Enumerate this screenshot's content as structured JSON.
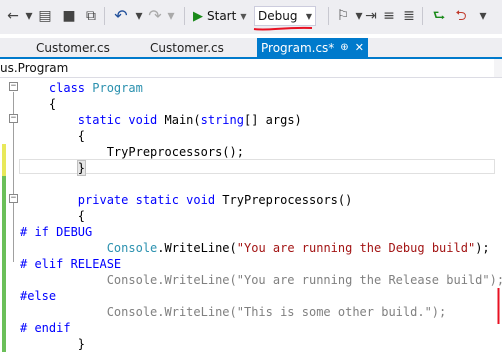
{
  "toolbar": {
    "start_label": "Start",
    "config_value": "Debug",
    "icons": [
      "navigate-back-icon",
      "dropdown-icon",
      "new-project-icon",
      "save-icon",
      "save-all-icon",
      "undo-icon",
      "redo-icon",
      "start-play-icon",
      "bookmark-icon",
      "step-icon",
      "format-icon",
      "comment-icon",
      "uncomment-icon"
    ]
  },
  "tabs": [
    {
      "label": "Customer.cs"
    },
    {
      "label": "Customer.cs"
    },
    {
      "label": "Program.cs*",
      "pin": "⊕",
      "close": "✕"
    }
  ],
  "navbar": {
    "scope": "us.Program"
  },
  "code_lines": [
    {
      "indent": 0,
      "parts": []
    },
    {
      "indent": 0,
      "parts": [
        {
          "t": "    class ",
          "c": "kw"
        },
        {
          "t": "Program",
          "c": "cls"
        }
      ]
    },
    {
      "indent": 0,
      "parts": [
        {
          "t": "    {",
          "c": ""
        }
      ]
    },
    {
      "indent": 0,
      "parts": [
        {
          "t": "        static void ",
          "c": "kw"
        },
        {
          "t": "Main(",
          "c": ""
        },
        {
          "t": "string",
          "c": "kw"
        },
        {
          "t": "[] args)",
          "c": ""
        }
      ]
    },
    {
      "indent": 0,
      "parts": [
        {
          "t": "        {",
          "c": ""
        }
      ]
    },
    {
      "indent": 0,
      "parts": [
        {
          "t": "            TryPreprocessors();",
          "c": ""
        }
      ]
    },
    {
      "indent": 0,
      "parts": [
        {
          "t": "        }",
          "c": ""
        }
      ]
    },
    {
      "indent": 0,
      "parts": []
    },
    {
      "indent": 0,
      "parts": [
        {
          "t": "        private static void ",
          "c": "kw"
        },
        {
          "t": "TryPreprocessors()",
          "c": ""
        }
      ]
    },
    {
      "indent": 0,
      "parts": [
        {
          "t": "        {",
          "c": ""
        }
      ]
    },
    {
      "indent": 0,
      "parts": [
        {
          "t": "# if DEBUG",
          "c": "pre"
        }
      ]
    },
    {
      "indent": 0,
      "parts": [
        {
          "t": "            ",
          "c": ""
        },
        {
          "t": "Console",
          "c": "cls"
        },
        {
          "t": ".WriteLine(",
          "c": ""
        },
        {
          "t": "\"You are running the Debug build\"",
          "c": "str"
        },
        {
          "t": ");",
          "c": ""
        }
      ]
    },
    {
      "indent": 0,
      "parts": [
        {
          "t": "# elif RELEASE",
          "c": "pre"
        }
      ]
    },
    {
      "indent": 0,
      "parts": [
        {
          "t": "            Console.WriteLine(\"You are running the Release build\");",
          "c": "dim"
        }
      ]
    },
    {
      "indent": 0,
      "parts": [
        {
          "t": "#else",
          "c": "pre"
        }
      ]
    },
    {
      "indent": 0,
      "parts": [
        {
          "t": "            Console.WriteLine(\"This is some other build.\");",
          "c": "dim"
        }
      ]
    },
    {
      "indent": 0,
      "parts": [
        {
          "t": "# endif",
          "c": "pre"
        }
      ]
    },
    {
      "indent": 0,
      "parts": [
        {
          "t": "        }",
          "c": ""
        }
      ]
    }
  ],
  "colors": {
    "accent": "#007acc",
    "keyword": "#0000ff",
    "type": "#2b91af",
    "string": "#a31515",
    "inactive_code": "#808080",
    "change_saved": "#6bbf59",
    "change_unsaved": "#e8e85a",
    "annotation_red": "#e81123"
  }
}
